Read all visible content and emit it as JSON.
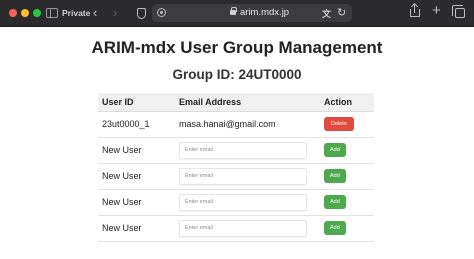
{
  "browser": {
    "private_label": "Private",
    "url": "arim.mdx.jp",
    "colors": {
      "chrome": "#2b2b2d",
      "close": "#ff5f57",
      "minimize": "#febc2e",
      "maximize": "#28c840"
    }
  },
  "page": {
    "title": "ARIM-mdx User Group Management",
    "group_id": "Group ID: 24UT0000"
  },
  "table": {
    "headers": {
      "user_id": "User ID",
      "email": "Email Address",
      "action": "Action"
    },
    "existing_rows": [
      {
        "user_id": "23ut0000_1",
        "email": "masa.hanai@gmail.com",
        "action": "Delete"
      }
    ],
    "new_rows": [
      {
        "user_id": "New User",
        "email_placeholder": "Enter email",
        "action": "Add"
      },
      {
        "user_id": "New User",
        "email_placeholder": "Enter email",
        "action": "Add"
      },
      {
        "user_id": "New User",
        "email_placeholder": "Enter email",
        "action": "Add"
      },
      {
        "user_id": "New User",
        "email_placeholder": "Enter email",
        "action": "Add"
      }
    ]
  },
  "colors": {
    "delete": "#e04a3f",
    "add": "#4ea84e",
    "header_bg": "#f0f0f0"
  },
  "icons": [
    "sidebar-icon",
    "back-icon",
    "forward-icon",
    "shield-icon",
    "page-settings-icon",
    "lock-icon",
    "translate-icon",
    "reload-icon",
    "share-icon",
    "new-tab-icon",
    "tab-overview-icon"
  ]
}
